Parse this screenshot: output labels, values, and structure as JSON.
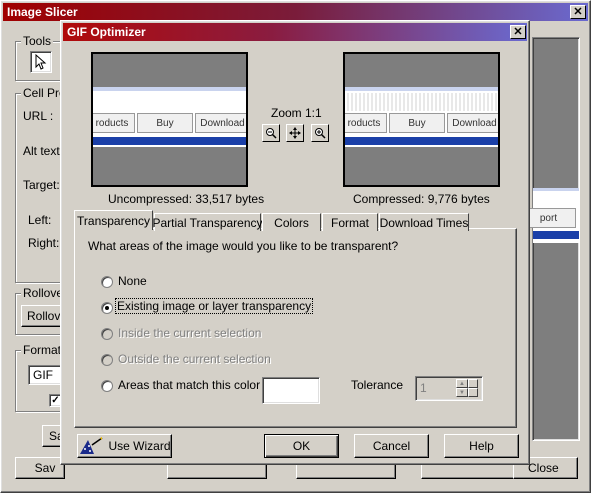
{
  "background_window": {
    "title": "Image Slicer",
    "tools_group": "Tools",
    "cell_props_group": "Cell Pro",
    "url_label": "URL :",
    "alt_label": "Alt text:",
    "target_label": "Target:",
    "left_label": "Left:",
    "right_label": "Right:",
    "rollover_group": "Rollove",
    "rollover_button": "Rollove",
    "format_group": "Format",
    "format_value": "GIF",
    "save_small": "Sa",
    "save_button": "Sav",
    "close_button": "Close",
    "preview_button_text": "port"
  },
  "dialog": {
    "title": "GIF Optimizer",
    "zoom_label": "Zoom 1:1",
    "uncompressed": "Uncompressed:  33,517 bytes",
    "compressed": "Compressed: 9,776 bytes",
    "preview_buttons": [
      "roducts",
      "Buy",
      "Download"
    ],
    "tabs": [
      "Transparency",
      "Partial Transparency",
      "Colors",
      "Format",
      "Download Times"
    ],
    "question": "What areas of the image would you like to be transparent?",
    "options": [
      {
        "label": "None",
        "selected": false,
        "enabled": true
      },
      {
        "label": "Existing image or layer transparency",
        "selected": true,
        "enabled": true
      },
      {
        "label": "Inside the current selection",
        "selected": false,
        "enabled": false
      },
      {
        "label": "Outside the current selection",
        "selected": false,
        "enabled": false
      },
      {
        "label": "Areas that match this color",
        "selected": false,
        "enabled": true
      }
    ],
    "tolerance_label": "Tolerance",
    "tolerance_value": "1",
    "wizard_button": "Use Wizard",
    "ok_button": "OK",
    "cancel_button": "Cancel",
    "help_button": "Help"
  },
  "colors": {
    "title_start": "#b00a0a",
    "title_end": "#6a6ad0",
    "face": "#d4d0c8",
    "strip_blue": "#1a3fa8"
  }
}
